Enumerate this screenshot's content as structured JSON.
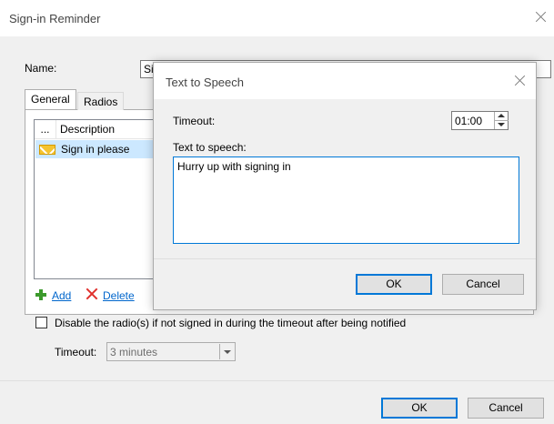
{
  "main_dialog": {
    "title": "Sign-in Reminder",
    "name_label": "Name:",
    "name_value": "Si",
    "tabs": [
      {
        "label": "General"
      },
      {
        "label": "Radios"
      }
    ],
    "list": {
      "columns": [
        "...",
        "Description"
      ],
      "rows": [
        {
          "icon": "envelope-icon",
          "description": "Sign in please"
        }
      ]
    },
    "add_label": "Add",
    "delete_label": "Delete",
    "disable_label": "Disable the radio(s) if not signed in during the timeout after being notified",
    "timeout_label": "Timeout:",
    "timeout_value": "3 minutes",
    "ok_label": "OK",
    "cancel_label": "Cancel"
  },
  "tts_dialog": {
    "title": "Text to Speech",
    "timeout_label": "Timeout:",
    "timeout_value": "01:00",
    "text_label": "Text to speech:",
    "text_value": "Hurry up with signing in",
    "ok_label": "OK",
    "cancel_label": "Cancel"
  },
  "colors": {
    "accent": "#0078d7",
    "selection": "#cce8ff",
    "link": "#0066cc",
    "add_icon": "#3c9a2c",
    "delete_icon": "#e0302c"
  }
}
